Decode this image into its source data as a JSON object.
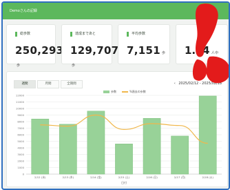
{
  "header": {
    "title": "Demoさんの記録"
  },
  "cards": [
    {
      "label": "総歩数",
      "value": "250,293",
      "unit": "歩"
    },
    {
      "label": "達成まであと",
      "value": "129,707",
      "unit": "歩"
    },
    {
      "label": "平均歩数",
      "value": "7,151",
      "unit": "歩"
    },
    {
      "label": "",
      "value": "1…4",
      "unit": "人中"
    }
  ],
  "tabs": [
    {
      "label": "週間",
      "active": true
    },
    {
      "label": "月間",
      "active": false
    },
    {
      "label": "全期間",
      "active": false
    }
  ],
  "date_range": "2025/02/12 - 2025/02/18",
  "colors": {
    "accent": "#5cb85c",
    "bar": "#98d298",
    "line": "#f0b74b",
    "sticker": "#e31b1b"
  },
  "icons": {
    "range_prev": "chevron-left-icon",
    "overlay": "red-figure-sticker"
  },
  "chart_data": {
    "type": "bar",
    "categories": [
      "2/12 (水)",
      "2/13 (木)",
      "2/14 (金)",
      "2/15 (土)",
      "2/16 (日)",
      "2/17 (月)",
      "2/18 (火)"
    ],
    "series": [
      {
        "name": "歩数",
        "type": "bar",
        "values": [
          8400,
          7600,
          9600,
          4600,
          8500,
          5800,
          11900
        ]
      },
      {
        "name": "%過去の歩数",
        "type": "line",
        "values": [
          7500,
          7300,
          9000,
          6800,
          7700,
          7400,
          4700
        ]
      }
    ],
    "legend": [
      "歩数",
      "%過去の歩数"
    ],
    "xlabel": "日付",
    "ylabel": "",
    "ylim": [
      0,
      12000
    ],
    "yticks": [
      0,
      1000,
      2000,
      3000,
      4000,
      5000,
      6000,
      7000,
      8000,
      9000,
      10000,
      11000,
      12000
    ],
    "grid": true
  }
}
